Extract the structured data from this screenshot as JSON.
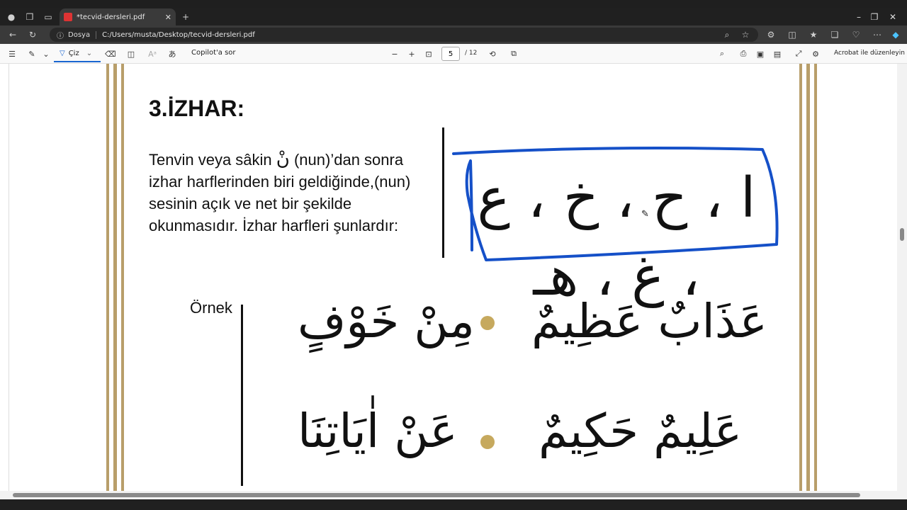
{
  "tab": {
    "title": "*tecvid-dersleri.pdf",
    "close": "✕",
    "newtab": "+"
  },
  "window": {
    "minimize": "–",
    "restore": "❐",
    "close": "✕"
  },
  "address": {
    "site_label": "Dosya",
    "url": "C:/Users/musta/Desktop/tecvid-dersleri.pdf"
  },
  "toolbar": {
    "draw_label": "Çiz",
    "copilot_label": "Copilot'a sor",
    "zoom_out": "−",
    "zoom_in": "+",
    "page_current": "5",
    "page_total": "/ 12",
    "edit_acrobat": "Acrobat ile düzenleyin"
  },
  "document": {
    "heading": "3.İZHAR:",
    "paragraph_a": "Tenvin veya sâkin ",
    "nun_glyph": "نْ",
    "paragraph_b": " (nun)’dan sonra izhar harflerinden biri geldiğinde,(nun) sesinin açık ve net bir şekilde okunmasıdır. İzhar harfleri şunlardır:",
    "izhar_letters": "ا ، ح ، خ ، ع ، غ ، هـ",
    "example_label": "Örnek",
    "examples": [
      "عَذَابٌ عَظِيمٌ",
      "مِنْ خَوْفٍ",
      "عَلِيمٌ حَكِيمٌ",
      "عَنْ اٰيَاتِنَا"
    ]
  },
  "colors": {
    "annotation_blue": "#1550c8",
    "gold": "#b89e6a",
    "bullet": "#c6a95e"
  }
}
